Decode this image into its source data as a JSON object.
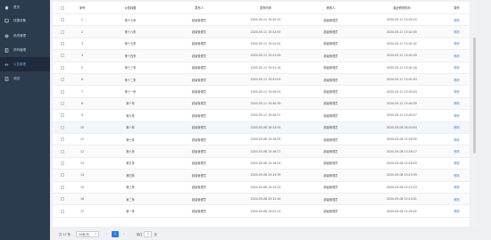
{
  "sidebar": {
    "items": [
      {
        "label": "首页",
        "icon": "home-icon"
      },
      {
        "label": "设置设备",
        "icon": "monitor-icon"
      },
      {
        "label": "系统管理",
        "icon": "gear-icon"
      },
      {
        "label": "学科管理",
        "icon": "book-icon"
      },
      {
        "label": "公告管理",
        "icon": "megaphone-icon",
        "active": true
      },
      {
        "label": "测试",
        "icon": "document-icon"
      }
    ]
  },
  "table": {
    "headers": {
      "index": "序号",
      "title": "公告标题",
      "publisher": "发布人",
      "publish_time": "发布时间",
      "modifier": "修改人",
      "modify_time": "最近修改时间",
      "operation": "操作"
    },
    "rows": [
      {
        "index": "1",
        "title": "第十七条",
        "publisher": "超级管理员",
        "publish_time": "2020-05-11 15:42:15",
        "modifier": "超级管理员",
        "modify_time": "2020-05-11 15:42:15",
        "op": "修改"
      },
      {
        "index": "2",
        "title": "第十六条",
        "publisher": "超级管理员",
        "publish_time": "2020-05-11 15:42:00",
        "modifier": "超级管理员",
        "modify_time": "2020-05-11 15:42:00",
        "op": "修改"
      },
      {
        "index": "3",
        "title": "第十五条",
        "publisher": "超级管理员",
        "publish_time": "2020-05-11 15:41:42",
        "modifier": "超级管理员",
        "modify_time": "2020-05-11 15:41:42",
        "op": "修改"
      },
      {
        "index": "4",
        "title": "第十四条",
        "publisher": "超级管理员",
        "publish_time": "2020-05-11 15:41:29",
        "modifier": "超级管理员",
        "modify_time": "2020-05-11 15:41:29",
        "op": "修改"
      },
      {
        "index": "5",
        "title": "第十三条",
        "publisher": "超级管理员",
        "publish_time": "2020-05-11 15:41:16",
        "modifier": "超级管理员",
        "modify_time": "2020-05-11 15:41:16",
        "op": "修改"
      },
      {
        "index": "6",
        "title": "第十二条",
        "publisher": "超级管理员",
        "publish_time": "2020-05-11 15:41:03",
        "modifier": "超级管理员",
        "modify_time": "2020-05-11 15:41:03",
        "op": "修改"
      },
      {
        "index": "7",
        "title": "第十一条",
        "publisher": "超级管理员",
        "publish_time": "2020-05-11 15:40:53",
        "modifier": "超级管理员",
        "modify_time": "2020-05-11 15:40:53",
        "op": "修改"
      },
      {
        "index": "8",
        "title": "第十条",
        "publisher": "超级管理员",
        "publish_time": "2020-05-11 15:40:39",
        "modifier": "超级管理员",
        "modify_time": "2020-05-11 15:40:39",
        "op": "修改"
      },
      {
        "index": "9",
        "title": "第九条",
        "publisher": "超级管理员",
        "publish_time": "2020-05-11 15:40:27",
        "modifier": "超级管理员",
        "modify_time": "2020-05-11 15:40:27",
        "op": "修改"
      },
      {
        "index": "10",
        "title": "第八条",
        "publisher": "超级管理员",
        "publish_time": "2020-05-08 16:24:54",
        "modifier": "超级管理员",
        "modify_time": "2020-05-08 16:24:54",
        "op": "修改"
      },
      {
        "index": "11",
        "title": "第七条",
        "publisher": "超级管理员",
        "publish_time": "2020-05-08 15:16:35",
        "modifier": "超级管理员",
        "modify_time": "2020-05-08 15:16:35",
        "op": "修改"
      },
      {
        "index": "12",
        "title": "第六条",
        "publisher": "超级管理员",
        "publish_time": "2020-05-08 15:16:17",
        "modifier": "超级管理员",
        "modify_time": "2020-05-08 15:16:17",
        "op": "修改"
      },
      {
        "index": "13",
        "title": "第五条",
        "publisher": "超级管理员",
        "publish_time": "2020-05-08 15:16:03",
        "modifier": "超级管理员",
        "modify_time": "2020-05-08 15:16:03",
        "op": "修改"
      },
      {
        "index": "14",
        "title": "第四条",
        "publisher": "超级管理员",
        "publish_time": "2020-05-08 15:15:39",
        "modifier": "超级管理员",
        "modify_time": "2020-05-08 15:15:39",
        "op": "修改"
      },
      {
        "index": "15",
        "title": "第三条",
        "publisher": "超级管理员",
        "publish_time": "2020-05-08 15:15:23",
        "modifier": "超级管理员",
        "modify_time": "2020-05-08 15:15:23",
        "op": "修改"
      },
      {
        "index": "16",
        "title": "第二条",
        "publisher": "超级管理员",
        "publish_time": "2020-05-08 15:12:44",
        "modifier": "超级管理员",
        "modify_time": "2020-05-08 15:14:51",
        "op": "修改"
      },
      {
        "index": "17",
        "title": "第一条",
        "publisher": "超级管理员",
        "publish_time": "2020-05-08 15:01:13",
        "modifier": "超级管理员",
        "modify_time": "2020-05-08 15:29:02",
        "op": "修改"
      }
    ]
  },
  "pager": {
    "total": "共 17 条",
    "page_size": "20条/页",
    "prev": "‹",
    "current": "1",
    "next": "›",
    "goto_label": "前往",
    "goto_value": "1",
    "goto_unit": "页"
  }
}
